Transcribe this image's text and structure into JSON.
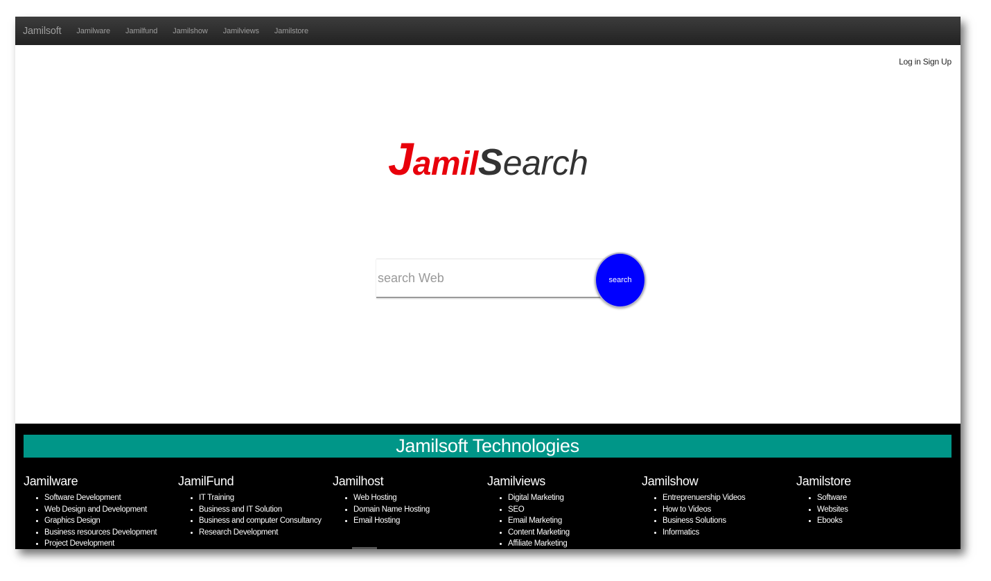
{
  "navbar": {
    "brand": "Jamilsoft",
    "links": [
      "Jamilware",
      "Jamilfund",
      "Jamilshow",
      "Jamilviews",
      "Jamilstore"
    ]
  },
  "auth": {
    "login": "Log in",
    "signup": "Sign Up"
  },
  "logo": {
    "part1_initial": "J",
    "part1_rest": "amil",
    "part2_initial": "S",
    "part2_rest": "earch",
    "colors": {
      "primary": "#e8000b",
      "secondary": "#333333"
    }
  },
  "search": {
    "placeholder": "search Web",
    "value": "",
    "button_label": "search",
    "button_color": "#0000ff"
  },
  "footer": {
    "title": "Jamilsoft Technologies",
    "banner_color": "#009688",
    "columns": [
      {
        "heading": "Jamilware",
        "items": [
          "Software Development",
          "Web Design and Development",
          "Graphics Design",
          "Business resources Development",
          "Project Development"
        ]
      },
      {
        "heading": "JamilFund",
        "items": [
          "IT Training",
          "Business and IT Solution",
          "Business and computer Consultancy",
          "Research Development"
        ]
      },
      {
        "heading": "Jamilhost",
        "items": [
          "Web Hosting",
          "Domain Name Hosting",
          "Email Hosting"
        ]
      },
      {
        "heading": "Jamilviews",
        "items": [
          "Digital Marketing",
          "SEO",
          "Email Marketing",
          "Content Marketing",
          "Affiliate Marketing"
        ]
      },
      {
        "heading": "Jamilshow",
        "items": [
          "Entreprenuership Videos",
          "How to Videos",
          "Business Solutions",
          "Informatics"
        ]
      },
      {
        "heading": "Jamilstore",
        "items": [
          "Software",
          "Websites",
          "Ebooks"
        ]
      }
    ]
  }
}
